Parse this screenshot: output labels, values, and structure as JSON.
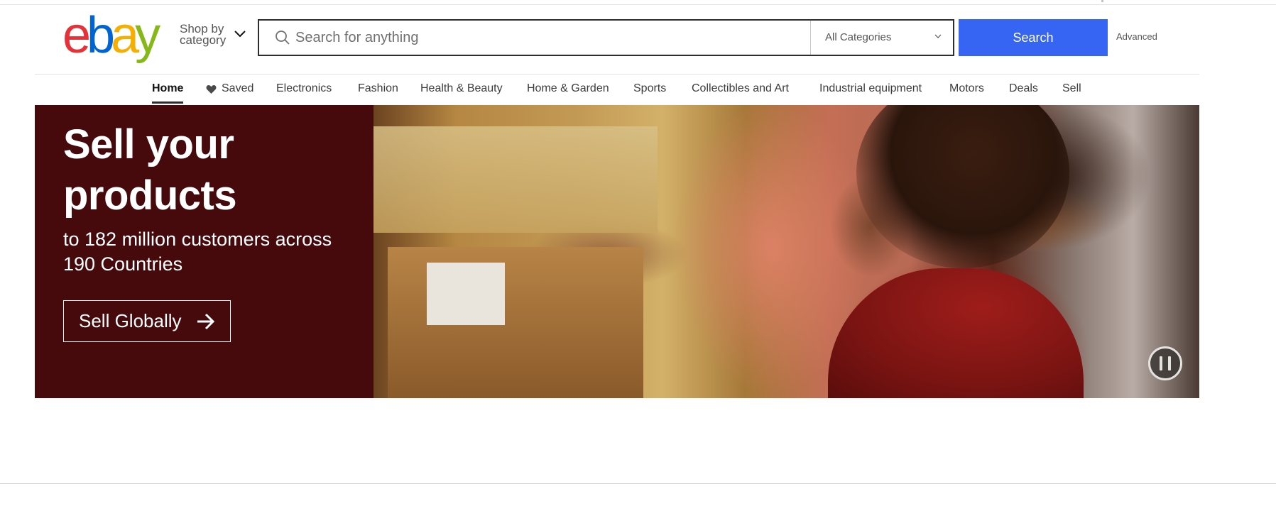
{
  "header": {
    "logo": {
      "letters": [
        "e",
        "b",
        "a",
        "y"
      ],
      "alt": "eBay"
    },
    "shop_by_category": {
      "line1": "Shop by",
      "line2": "category"
    },
    "search": {
      "placeholder": "Search for anything",
      "value": "",
      "category_selected": "All Categories",
      "button_label": "Search"
    },
    "advanced_label": "Advanced"
  },
  "nav": {
    "items": [
      {
        "label": "Home",
        "active": true
      },
      {
        "label": "Saved",
        "icon": "heart-icon"
      },
      {
        "label": "Electronics"
      },
      {
        "label": "Fashion"
      },
      {
        "label": "Health & Beauty"
      },
      {
        "label": "Home & Garden"
      },
      {
        "label": "Sports"
      },
      {
        "label": "Collectibles and Art"
      },
      {
        "label": "Industrial equipment"
      },
      {
        "label": "Motors"
      },
      {
        "label": "Deals"
      },
      {
        "label": "Sell"
      }
    ]
  },
  "hero": {
    "title_line1": "Sell your",
    "title_line2": "products",
    "subtitle": "to 182 million customers across 190 Countries",
    "cta_label": "Sell Globally",
    "cta_icon": "arrow-right-icon",
    "pause_icon": "pause-icon",
    "colors": {
      "panel": "#460a0d",
      "search_button": "#3665f3"
    }
  }
}
